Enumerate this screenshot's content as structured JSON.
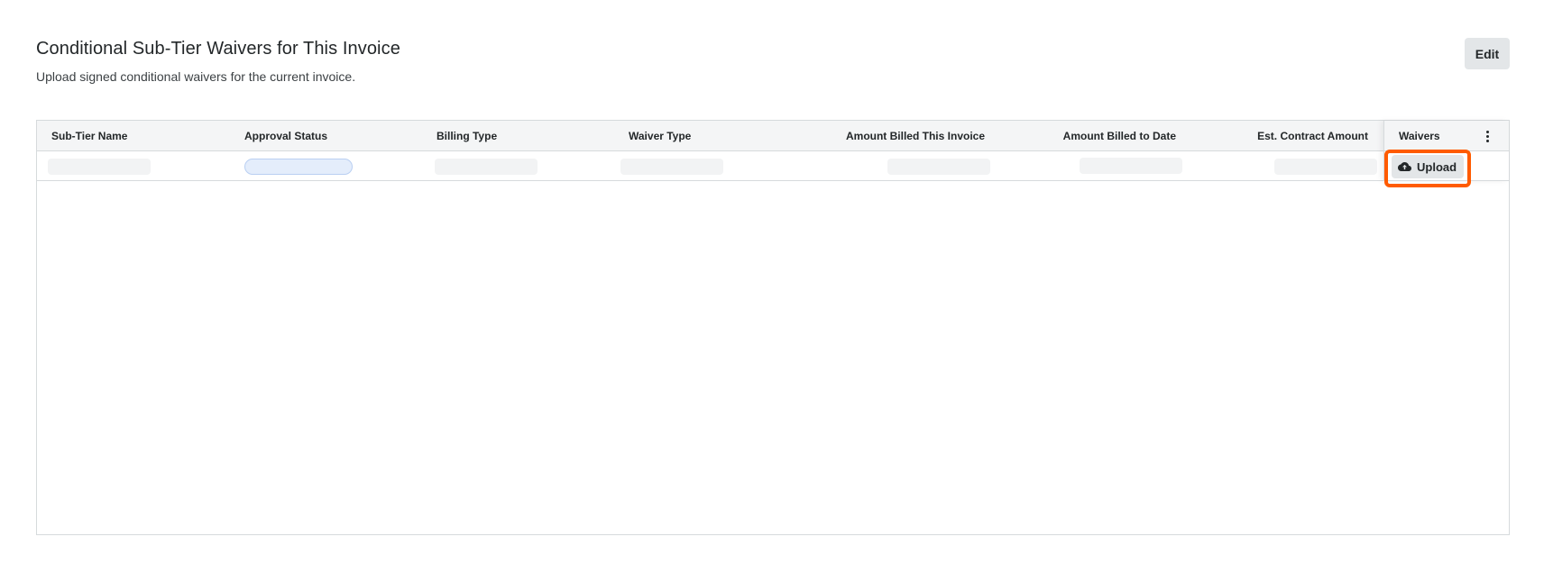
{
  "section": {
    "title": "Conditional Sub-Tier Waivers for This Invoice",
    "subtitle": "Upload signed conditional waivers for the current invoice.",
    "edit_label": "Edit"
  },
  "table": {
    "columns": [
      {
        "label": "Sub-Tier Name"
      },
      {
        "label": "Approval Status"
      },
      {
        "label": "Billing Type"
      },
      {
        "label": "Waiver Type"
      },
      {
        "label": "Amount Billed This Invoice"
      },
      {
        "label": "Amount Billed to Date"
      },
      {
        "label": "Est. Contract Amount"
      }
    ],
    "waivers_column": {
      "label": "Waivers",
      "menu_icon": "kebab-menu-icon"
    },
    "rows": [
      {
        "state": "loading",
        "upload_label": "Upload",
        "upload_icon": "cloud-upload-icon"
      }
    ]
  },
  "colors": {
    "highlight": "#ff5b00",
    "header_bg": "#f4f5f6",
    "border": "#d6dadc",
    "button_bg": "#e3e6e8",
    "skeleton": "#f2f3f4",
    "status_skeleton": "#e4edfb"
  }
}
